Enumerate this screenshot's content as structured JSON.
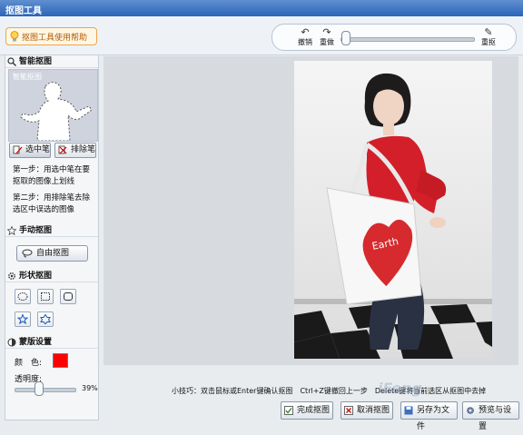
{
  "window": {
    "title": "抠图工具"
  },
  "toolbar": {
    "help_label": "抠图工具使用帮助",
    "undo_label": "撤销",
    "redo_label": "重做",
    "reselect_label": "重抠",
    "zoom_level": 0.05
  },
  "sidebar": {
    "smart": {
      "title": "智能抠图",
      "thumb_label": "智能抠图",
      "select_pen_label": "选中笔",
      "exclude_pen_label": "排除笔",
      "step1": "第一步：用选中笔在要抠取的图像上划线",
      "step2": "第二步：用排除笔去除选区中误选的图像"
    },
    "manual": {
      "title": "手动抠图",
      "free_label": "自由抠图"
    },
    "shape": {
      "title": "形状抠图",
      "shapes": [
        "ellipse-icon",
        "rectangle-icon",
        "rounded-rect-icon",
        "star-icon",
        "hexagram-icon"
      ]
    },
    "mask": {
      "title": "蒙版设置",
      "color_label": "颜　色:",
      "color_value": "#ff0000",
      "opacity_label": "透明度:",
      "opacity_value": "39%",
      "opacity_level": 0.39
    }
  },
  "status": {
    "tip": "小技巧：双击鼠标或Enter键确认抠图　Ctrl+Z键撤回上一步　Delete键将当前选区从抠图中去掉"
  },
  "buttons": {
    "finish": "完成抠图",
    "cancel": "取消抠图",
    "save_as": "另存为文件",
    "preview": "预览与设置"
  },
  "photo": {
    "bag_text": "Earth"
  },
  "watermark": "iFeng"
}
